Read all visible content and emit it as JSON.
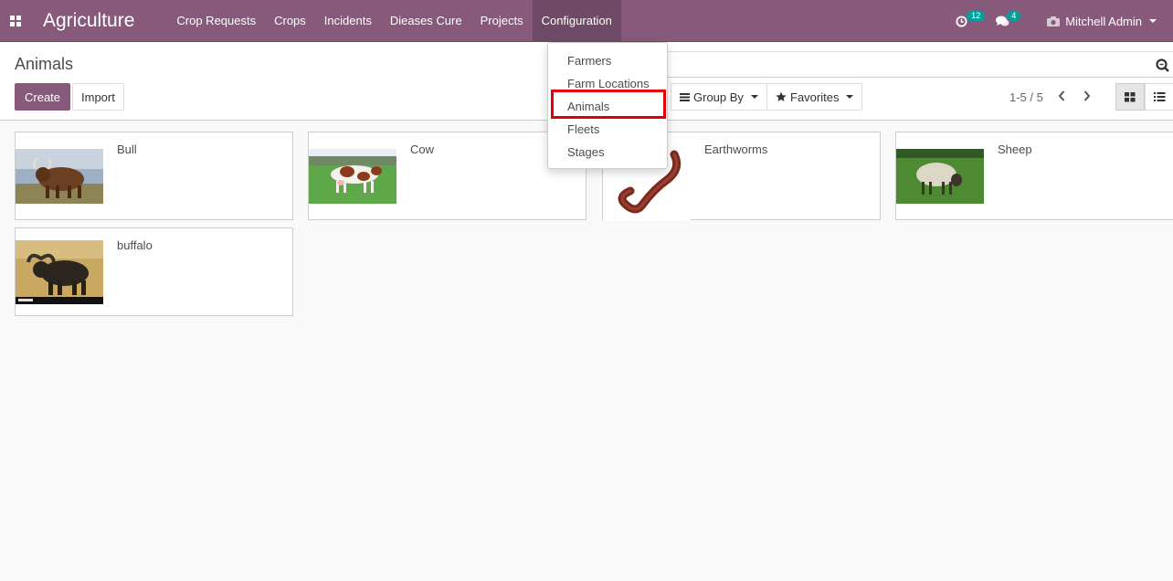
{
  "navbar": {
    "app_title": "Agriculture",
    "menu": [
      "Crop Requests",
      "Crops",
      "Incidents",
      "Dieases Cure",
      "Projects",
      "Configuration"
    ],
    "activity_count": "12",
    "messages_count": "4",
    "user_name": "Mitchell Admin",
    "accent_color": "#875a7b",
    "badge_color": "#00a09d"
  },
  "control_panel": {
    "breadcrumb": "Animals",
    "create_label": "Create",
    "import_label": "Import",
    "group_by_label": "Group By",
    "favorites_label": "Favorites",
    "pager_text": "1-5 / 5"
  },
  "configuration_menu": {
    "items": [
      "Farmers",
      "Farm Locations",
      "Animals",
      "Fleets",
      "Stages"
    ],
    "highlighted_item": "Animals",
    "highlight_color": "#e0000a"
  },
  "kanban": {
    "records": [
      {
        "name": "Bull",
        "image": "bull-photo"
      },
      {
        "name": "Cow",
        "image": "cow-photo"
      },
      {
        "name": "Earthworms",
        "image": "earthworm-photo"
      },
      {
        "name": "Sheep",
        "image": "sheep-photo"
      },
      {
        "name": "buffalo",
        "image": "buffalo-photo"
      }
    ]
  }
}
